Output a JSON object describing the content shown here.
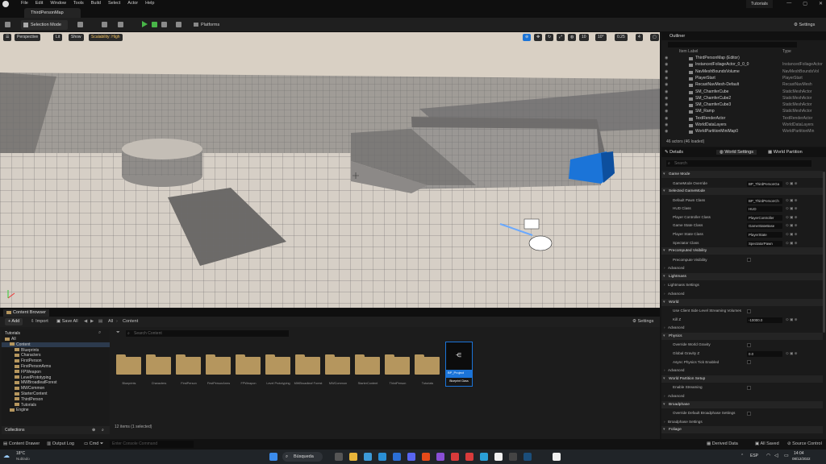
{
  "menubar": {
    "items": [
      "File",
      "Edit",
      "Window",
      "Tools",
      "Build",
      "Select",
      "Actor",
      "Help"
    ],
    "tutorials": "Tutorials",
    "win": [
      "—",
      "▢",
      "✕"
    ]
  },
  "tab": {
    "map": "ThirdPersonMap"
  },
  "toolbar": {
    "mode": "Selection Mode",
    "platforms": "Platforms",
    "settings": "Settings"
  },
  "viewport": {
    "perspective": "Perspective",
    "lit": "Lit",
    "show": "Show",
    "scalability": "Scalability: High",
    "grid": "10",
    "angle": "10°",
    "scale": "0.25",
    "cam": "4"
  },
  "outliner": {
    "title": "Outliner",
    "col_label": "Item Label",
    "col_type": "Type",
    "rows": [
      {
        "name": "ThirdPersonMap (Editor)",
        "type": ""
      },
      {
        "name": "InstancedFoliageActor_0_0_0",
        "type": "InstancedFoliageActor"
      },
      {
        "name": "NavMeshBoundsVolume",
        "type": "NavMeshBoundsVol"
      },
      {
        "name": "PlayerStart",
        "type": "PlayerStart"
      },
      {
        "name": "RecastNavMesh-Default",
        "type": "RecastNavMesh"
      },
      {
        "name": "SM_ChamferCube",
        "type": "StaticMeshActor"
      },
      {
        "name": "SM_ChamferCube2",
        "type": "StaticMeshActor"
      },
      {
        "name": "SM_ChamferCube3",
        "type": "StaticMeshActor"
      },
      {
        "name": "SM_Ramp",
        "type": "StaticMeshActor"
      },
      {
        "name": "TextRenderActor",
        "type": "TextRenderActor"
      },
      {
        "name": "WorldDataLayers",
        "type": "WorldDataLayers"
      },
      {
        "name": "WorldPartitionMiniMap0",
        "type": "WorldPartitionMin"
      }
    ],
    "count": "46 actors (46 loaded)"
  },
  "details": {
    "tabs": [
      "Details",
      "World Settings",
      "World Partition"
    ],
    "search_placeholder": "Search",
    "rows": [
      {
        "kind": "sec",
        "label": "Game Mode"
      },
      {
        "kind": "prop",
        "label": "GameMode Override",
        "value": "BP_ThirdPersonGa"
      },
      {
        "kind": "sec",
        "label": "Selected GameMode"
      },
      {
        "kind": "prop",
        "label": "Default Pawn Class",
        "value": "BP_ThirdPersonCh"
      },
      {
        "kind": "prop",
        "label": "HUD Class",
        "value": "HUD"
      },
      {
        "kind": "prop",
        "label": "Player Controller Class",
        "value": "PlayerController"
      },
      {
        "kind": "prop",
        "label": "Game State Class",
        "value": "GameStateBase"
      },
      {
        "kind": "prop",
        "label": "Player State Class",
        "value": "PlayerState"
      },
      {
        "kind": "prop",
        "label": "Spectator Class",
        "value": "SpectatorPawn"
      },
      {
        "kind": "sec",
        "label": "Precomputed Visibility"
      },
      {
        "kind": "check",
        "label": "Precompute Visibility"
      },
      {
        "kind": "sub",
        "label": "Advanced"
      },
      {
        "kind": "sec",
        "label": "Lightmass"
      },
      {
        "kind": "sub",
        "label": "Lightmass Settings"
      },
      {
        "kind": "sub",
        "label": "Advanced"
      },
      {
        "kind": "sec",
        "label": "World"
      },
      {
        "kind": "check",
        "label": "Use Client Side Level Streaming Volumes"
      },
      {
        "kind": "prop",
        "label": "Kill Z",
        "value": "-10000.0"
      },
      {
        "kind": "sub",
        "label": "Advanced"
      },
      {
        "kind": "sec",
        "label": "Physics"
      },
      {
        "kind": "check",
        "label": "Override World Gravity"
      },
      {
        "kind": "prop",
        "label": "Global Gravity Z",
        "value": "0.0"
      },
      {
        "kind": "check",
        "label": "Async Physics Tick Enabled"
      },
      {
        "kind": "sub",
        "label": "Advanced"
      },
      {
        "kind": "sec",
        "label": "World Partition Setup"
      },
      {
        "kind": "check",
        "label": "Enable Streaming"
      },
      {
        "kind": "sub",
        "label": "Advanced"
      },
      {
        "kind": "sec",
        "label": "Broadphase"
      },
      {
        "kind": "check",
        "label": "Override Default Broadphase Settings"
      },
      {
        "kind": "sub",
        "label": "Broadphase Settings"
      },
      {
        "kind": "sec",
        "label": "Foliage"
      }
    ]
  },
  "content_browser": {
    "tab": "Content Browser",
    "add": "+ Add",
    "import": "Import",
    "save_all": "Save All",
    "crumbs": [
      "All",
      "Content"
    ],
    "settings": "Settings",
    "tree_header": "Tutorials",
    "tree": [
      {
        "label": "All",
        "indent": 0
      },
      {
        "label": "Content",
        "indent": 1,
        "selected": true
      },
      {
        "label": "Blueprints",
        "indent": 2
      },
      {
        "label": "Characters",
        "indent": 2
      },
      {
        "label": "FirstPerson",
        "indent": 2
      },
      {
        "label": "FirstPersonArms",
        "indent": 2
      },
      {
        "label": "FPWeapon",
        "indent": 2
      },
      {
        "label": "LevelPrototyping",
        "indent": 2
      },
      {
        "label": "MWBroadleafForest",
        "indent": 2
      },
      {
        "label": "MWCommon",
        "indent": 2
      },
      {
        "label": "StarterContent",
        "indent": 2
      },
      {
        "label": "ThirdPerson",
        "indent": 2
      },
      {
        "label": "Tutorials",
        "indent": 2
      },
      {
        "label": "Engine",
        "indent": 1
      }
    ],
    "search_placeholder": "Search Content",
    "folders": [
      "Blueprints",
      "Characters",
      "FirstPerson",
      "FirstPersonArms",
      "FPWeapon",
      "Level Prototyping",
      "MWBroadleaf Forest",
      "MWCommon",
      "StarterContent",
      "ThirdPerson",
      "Tutorials"
    ],
    "asset": {
      "name": "BP_Project",
      "type": "Blueprint Class"
    },
    "item_count": "12 items (1 selected)",
    "collections": "Collections"
  },
  "statusbar": {
    "content_drawer": "Content Drawer",
    "output_log": "Output Log",
    "cmd": "Cmd",
    "console_placeholder": "Enter Console Command",
    "derived": "Derived Data",
    "all_saved": "All Saved",
    "source_control": "Source Control"
  },
  "taskbar": {
    "weather_temp": "18°C",
    "weather_desc": "Nublado",
    "search": "Búsqueda",
    "lang": "ESP",
    "time": "14:04",
    "date": "08/12/2022"
  },
  "colors": {
    "accent": "#1b74d8",
    "play": "#48b548",
    "folder": "#b5965e",
    "scalability": "#f0c060"
  }
}
